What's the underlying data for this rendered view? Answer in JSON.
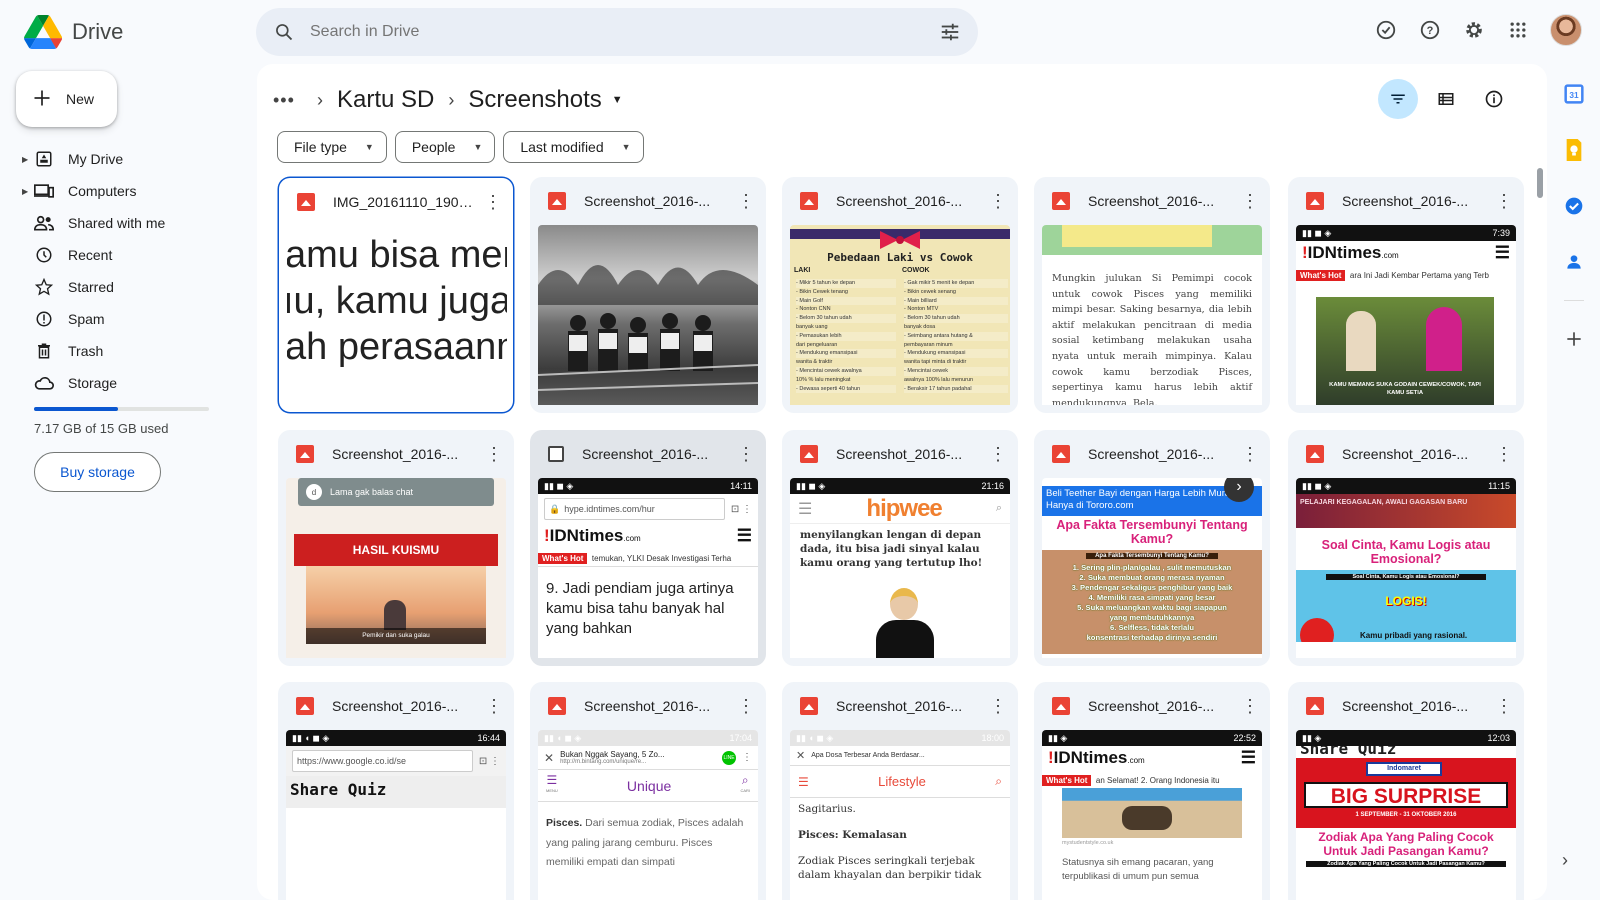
{
  "app": {
    "name": "Drive"
  },
  "search": {
    "placeholder": "Search in Drive"
  },
  "new_button": {
    "label": "New"
  },
  "sidebar": {
    "items": [
      {
        "label": "My Drive",
        "icon": "my-drive-icon",
        "expandable": true
      },
      {
        "label": "Computers",
        "icon": "computers-icon",
        "expandable": true
      },
      {
        "label": "Shared with me",
        "icon": "shared-icon",
        "expandable": false
      },
      {
        "label": "Recent",
        "icon": "clock-icon",
        "expandable": false
      },
      {
        "label": "Starred",
        "icon": "star-icon",
        "expandable": false
      },
      {
        "label": "Spam",
        "icon": "spam-icon",
        "expandable": false
      },
      {
        "label": "Trash",
        "icon": "trash-icon",
        "expandable": false
      },
      {
        "label": "Storage",
        "icon": "cloud-icon",
        "expandable": false
      }
    ],
    "storage_text": "7.17 GB of 15 GB used",
    "storage_used_fraction": 0.478,
    "buy_storage": "Buy storage"
  },
  "breadcrumb": {
    "more": "•••",
    "parent": "Kartu SD",
    "current": "Screenshots"
  },
  "filters": [
    "File type",
    "People",
    "Last modified"
  ],
  "files": [
    {
      "name": "IMG_20161110_1901...",
      "thumb": "bigtext"
    },
    {
      "name": "Screenshot_2016-...",
      "thumb": "photo"
    },
    {
      "name": "Screenshot_2016-...",
      "thumb": "table"
    },
    {
      "name": "Screenshot_2016-...",
      "thumb": "para"
    },
    {
      "name": "Screenshot_2016-...",
      "thumb": "idn_poster"
    },
    {
      "name": "Screenshot_2016-...",
      "thumb": "kuis"
    },
    {
      "name": "Screenshot_2016-...",
      "thumb": "idn_article"
    },
    {
      "name": "Screenshot_2016-...",
      "thumb": "hipwee"
    },
    {
      "name": "Screenshot_2016-...",
      "thumb": "fakta"
    },
    {
      "name": "Screenshot_2016-...",
      "thumb": "cinta"
    },
    {
      "name": "Screenshot_2016-...",
      "thumb": "sharequiz"
    },
    {
      "name": "Screenshot_2016-...",
      "thumb": "unique"
    },
    {
      "name": "Screenshot_2016-...",
      "thumb": "lifestyle"
    },
    {
      "name": "Screenshot_2016-...",
      "thumb": "idn_beach"
    },
    {
      "name": "Screenshot_2016-...",
      "thumb": "surprise"
    }
  ],
  "thumbs": {
    "bigtext": [
      "amu bisa meng",
      "ıu, kamu juga k",
      "ah perasaanm"
    ],
    "table": {
      "title": "Pebedaan Laki vs Cowok",
      "left": "LAKI",
      "right": "COWOK",
      "left_rows": [
        "- Mikir 5 tahun ke depan",
        "- Bikin Cewek tenang",
        "- Main Golf",
        "- Nonton CNN",
        "- Belom 30 tahun udah",
        "  banyak uang",
        "- Pemasukan lebih",
        "  dari pengeluaran",
        "- Mendukung emansipasi",
        "  wanita & traktir",
        "- Mencintai cewek awalnya",
        "  10% % lalu meningkat",
        "- Dewasa seperti 40 tahun"
      ],
      "right_rows": [
        "- Gak mikir 5 menit ke depan",
        "- Bikin cewek senang",
        "- Main billiard",
        "- Nonton MTV",
        "- Belom 30 tahun udah",
        "  banyak dosa",
        "- Seimbang antara hutang &",
        "  pembayaran minum",
        "- Mendukung emansipasi",
        "  wanita tapi minta di traktir",
        "- Mencintai cewek",
        "  awalnya 100% lalu menurun",
        "- Beraksir 17 tahun padahal"
      ]
    },
    "para": "Mungkin julukan Si Pemimpi cocok untuk cowok Pisces yang memiliki mimpi besar. Saking besarnya, dia lebih aktif melakukan pencitraan di media sosial ketimbang melakukan usaha nyata untuk meraih mimpinya. Kalau cowok kamu berzodiak Pisces, sepertinya kamu harus lebih aktif mendukungnya, Bela.",
    "idn_poster": {
      "time": "7:39",
      "brand": "IDNtimes",
      "domain": ".com",
      "whats_hot": "What's Hot",
      "ticker": "ara Ini Jadi Kembar Pertama yang Terb",
      "caption": "KAMU MEMANG SUKA GODAIN CEWEK/COWOK, TAPI KAMU SETIA"
    },
    "kuis": {
      "chip": "Lama gak balas chat",
      "avatar": "d",
      "banner": "HASIL KUISMU",
      "caption": "Pemikir dan suka galau"
    },
    "idn_article": {
      "time": "14:11",
      "url": "hype.idntimes.com/hur",
      "brand": "IDNtimes",
      "domain": ".com",
      "whats_hot": "What's Hot",
      "ticker": "temukan, YLKI Desak Investigasi Terha",
      "body": "9. Jadi pendiam juga artinya kamu bisa tahu banyak hal yang bahkan"
    },
    "hipwee": {
      "time": "21:16",
      "brand": "hipwee",
      "body": "menyilangkan lengan di depan dada, itu bisa jadi sinyal kalau kamu orang yang tertutup lho!"
    },
    "fakta": {
      "ad": "Beli Teether Bayi dengan Harga Lebih Murah. Hanya di Tororo.com",
      "title": "Apa Fakta Tersembunyi Tentang Kamu?",
      "heading": "Apa Fakta Tersembunyi Tentang Kamu?",
      "items": [
        "1. Sering plin-plan/galau , sulit memutuskan",
        "2. Suka membuat orang merasa nyaman",
        "3. Pendengar sekaligus penghibur yang baik",
        "4. Memiliki rasa simpati yang besar",
        "5. Suka meluangkan waktu bagi siapapun",
        "yang membutuhkannya",
        "6. Selfless, tidak terlalu",
        "konsentrasi terhadap dirinya sendiri"
      ]
    },
    "cinta": {
      "time": "11:15",
      "banner": "PELAJARI KEGAGALAN, AWALI GAGASAN BARU",
      "title": "Soal Cinta, Kamu Logis atau Emosional?",
      "sub": "Soal Cinta, Kamu Logis atau Emosional?",
      "result": "LOGIS!",
      "foot": "Kamu pribadi yang rasional."
    },
    "sharequiz": {
      "time": "16:44",
      "url": "https://www.google.co.id/se",
      "title": "Share Quiz"
    },
    "unique": {
      "time": "17:04",
      "title": "Bukan Nggak Sayang, 5 Zo...",
      "url": "http://m.bintang.com/unique/re...",
      "section": "Unique",
      "menu": "MENU",
      "cari": "CARI",
      "lead": "Pisces.",
      "body": "Dari semua zodiak, Pisces adalah yang paling jarang cemburu. Pisces memiliki empati dan simpati"
    },
    "lifestyle": {
      "time": "18:00",
      "title": "Apa Dosa Terbesar Anda Berdasar...",
      "section": "Lifestyle",
      "p1": "Sagitarius.",
      "p2": "Pisces: Kemalasan",
      "p3": "Zodiak Pisces seringkali terjebak dalam khayalan dan berpikir tidak"
    },
    "idn_beach": {
      "time": "22:52",
      "brand": "IDNtimes",
      "domain": ".com",
      "whats_hot": "What's Hot",
      "ticker": "an Selamat!   2. Orang Indonesia itu",
      "credit": "mystudentstyle.co.uk",
      "body": "Statusnya sih emang pacaran, yang terpublikasi di umum pun semua"
    },
    "surprise": {
      "time": "12:03",
      "top": "Share Quiz",
      "brand": "Indomaret",
      "big": "BIG SURPRISE",
      "dates": "1 SEPTEMBER - 31 OKTOBER 2016",
      "title": "Zodiak Apa Yang Paling Cocok Untuk Jadi Pasangan Kamu?",
      "sub": "Zodiak Apa Yang Paling Cocok Untuk Jadi Pasangan Kamu?"
    }
  },
  "colors": {
    "accent": "#0b57d0",
    "selected_chip": "#c2e7ff",
    "panel": "#f0f4f9",
    "red": "#e02020"
  }
}
